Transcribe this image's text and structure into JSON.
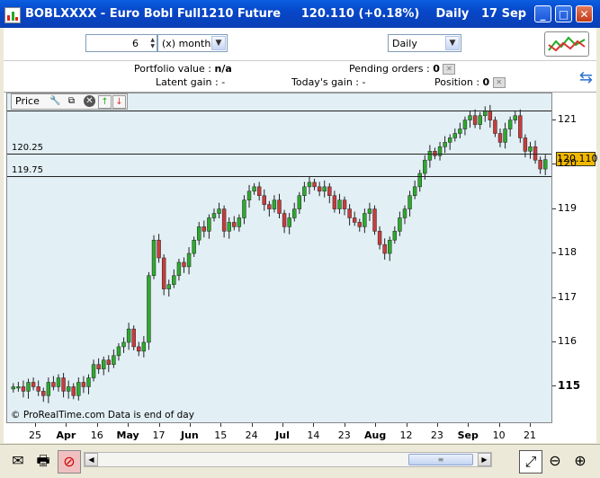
{
  "window": {
    "title": "BOBLXXXX - Euro Bobl Full1210 Future     120.110 (+0.18%)    Daily   17 Sep",
    "controls": [
      "_",
      "□",
      "✕"
    ]
  },
  "toolbar": {
    "period_value": "6",
    "period_unit": "(x) months",
    "interval": "Daily"
  },
  "info": {
    "portfolio_label": "Portfolio value :",
    "portfolio_value": "n/a",
    "pending_label": "Pending orders :",
    "pending_value": "0",
    "latent_label": "Latent gain :",
    "latent_value": "-",
    "today_label": "Today's gain :",
    "today_value": "-",
    "position_label": "Position :",
    "position_value": "0"
  },
  "panel": {
    "label": "Price"
  },
  "levels": [
    {
      "label": "120.25",
      "value": 120.25
    },
    {
      "label": "119.75",
      "value": 119.75
    }
  ],
  "current_price": "120.110",
  "yaxis": {
    "ticks": [
      "121",
      "120",
      "119",
      "118",
      "117",
      "116",
      "115"
    ],
    "bold_tick": "115"
  },
  "xaxis": {
    "ticks": [
      {
        "label": "25",
        "bold": false
      },
      {
        "label": "Apr",
        "bold": true
      },
      {
        "label": "16",
        "bold": false
      },
      {
        "label": "May",
        "bold": true
      },
      {
        "label": "17",
        "bold": false
      },
      {
        "label": "Jun",
        "bold": true
      },
      {
        "label": "15",
        "bold": false
      },
      {
        "label": "24",
        "bold": false
      },
      {
        "label": "Jul",
        "bold": true
      },
      {
        "label": "14",
        "bold": false
      },
      {
        "label": "23",
        "bold": false
      },
      {
        "label": "Aug",
        "bold": true
      },
      {
        "label": "12",
        "bold": false
      },
      {
        "label": "23",
        "bold": false
      },
      {
        "label": "Sep",
        "bold": true
      },
      {
        "label": "10",
        "bold": false
      },
      {
        "label": "21",
        "bold": false
      }
    ]
  },
  "footnote": "© ProRealTime.com  Data is end of day",
  "colors": {
    "up": "#2eaa2e",
    "down": "#c83c3c",
    "plot_bg": "#e2eff5",
    "price_tag": "#f2b800"
  },
  "chart_data": {
    "type": "candlestick",
    "ylim": [
      114.2,
      121.6
    ],
    "closes": [
      115.0,
      115.0,
      114.9,
      115.1,
      115.0,
      114.9,
      114.8,
      115.1,
      115.0,
      115.2,
      114.9,
      115.0,
      114.8,
      115.1,
      115.0,
      115.2,
      115.5,
      115.4,
      115.6,
      115.5,
      115.7,
      115.9,
      116.0,
      116.3,
      115.9,
      115.8,
      116.0,
      117.5,
      118.3,
      117.9,
      117.2,
      117.3,
      117.5,
      117.8,
      117.7,
      118.0,
      118.3,
      118.6,
      118.5,
      118.8,
      118.9,
      119.0,
      118.5,
      118.7,
      118.6,
      118.8,
      119.2,
      119.4,
      119.5,
      119.3,
      119.1,
      119.0,
      119.2,
      118.9,
      118.6,
      118.8,
      119.0,
      119.3,
      119.5,
      119.6,
      119.5,
      119.4,
      119.5,
      119.3,
      119.0,
      119.2,
      119.0,
      118.8,
      118.7,
      118.6,
      118.9,
      119.0,
      118.5,
      118.2,
      118.0,
      118.3,
      118.5,
      118.8,
      119.0,
      119.3,
      119.5,
      119.8,
      120.1,
      120.3,
      120.2,
      120.4,
      120.5,
      120.6,
      120.7,
      120.8,
      121.0,
      121.1,
      120.9,
      121.1,
      121.2,
      121.0,
      120.7,
      120.5,
      120.8,
      121.0,
      121.1,
      120.6,
      120.3,
      120.4,
      120.1,
      119.9,
      120.11
    ]
  }
}
